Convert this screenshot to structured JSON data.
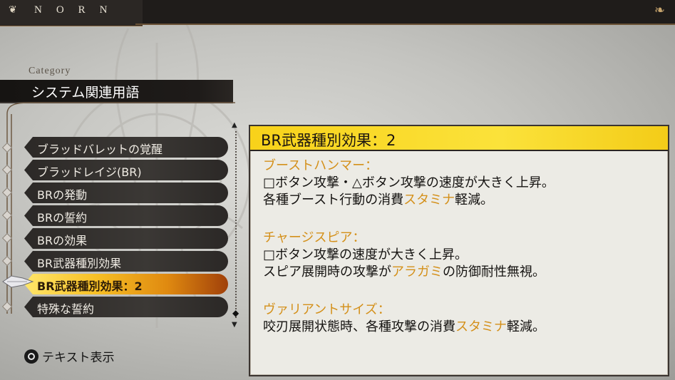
{
  "header": {
    "logo_text": "NORN"
  },
  "category": {
    "label": "Category",
    "title": "システム関連用語"
  },
  "menu": {
    "items": [
      {
        "label": "ブラッドバレットの覚醒"
      },
      {
        "label": "ブラッドレイジ(BR)"
      },
      {
        "label": "BRの発動"
      },
      {
        "label": "BRの誓約"
      },
      {
        "label": "BRの効果"
      },
      {
        "label": "BR武器種別効果"
      },
      {
        "label": "BR武器種別効果：2"
      },
      {
        "label": "特殊な誓約"
      }
    ],
    "selected_index": 6
  },
  "footer": {
    "button_icon": "circle-button-icon",
    "hint_label": "テキスト表示"
  },
  "detail": {
    "title": "BR武器種別効果：2",
    "sections": [
      {
        "heading": "ブーストハンマー：",
        "line1": "□ボタン攻撃・△ボタン攻撃の速度が大きく上昇。",
        "line2_pre": "各種ブースト行動の消費",
        "line2_hl": "スタミナ",
        "line2_post": "軽減。"
      },
      {
        "heading": "チャージスピア：",
        "line1": "□ボタン攻撃の速度が大きく上昇。",
        "line2_pre": "スピア展開時の攻撃が",
        "line2_hl": "アラガミ",
        "line2_post": "の防御耐性無視。"
      },
      {
        "heading": "ヴァリアントサイズ：",
        "line1_pre": "咬刃展開状態時、各種攻撃の消費",
        "line1_hl": "スタミナ",
        "line1_post": "軽減。"
      }
    ]
  },
  "colors": {
    "highlight": "#d4901a",
    "title_bar": "#f8d21a",
    "selected_item": "#f7c026"
  }
}
